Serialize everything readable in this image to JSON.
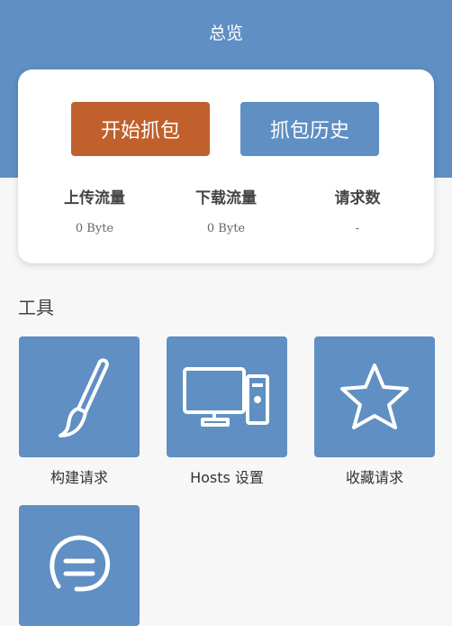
{
  "header": {
    "title": "总览"
  },
  "buttons": {
    "start": "开始抓包",
    "history": "抓包历史"
  },
  "stats": [
    {
      "label": "上传流量",
      "value": "0 Byte"
    },
    {
      "label": "下载流量",
      "value": "0 Byte"
    },
    {
      "label": "请求数",
      "value": "-"
    }
  ],
  "section": {
    "title": "工具"
  },
  "tools": [
    {
      "label": "构建请求",
      "icon": "paintbrush-icon"
    },
    {
      "label": "Hosts 设置",
      "icon": "computer-icon"
    },
    {
      "label": "收藏请求",
      "icon": "star-icon"
    },
    {
      "label": "",
      "icon": "chat-bubble-icon"
    }
  ],
  "colors": {
    "accent": "#5f8fc3",
    "start": "#c0602d"
  }
}
